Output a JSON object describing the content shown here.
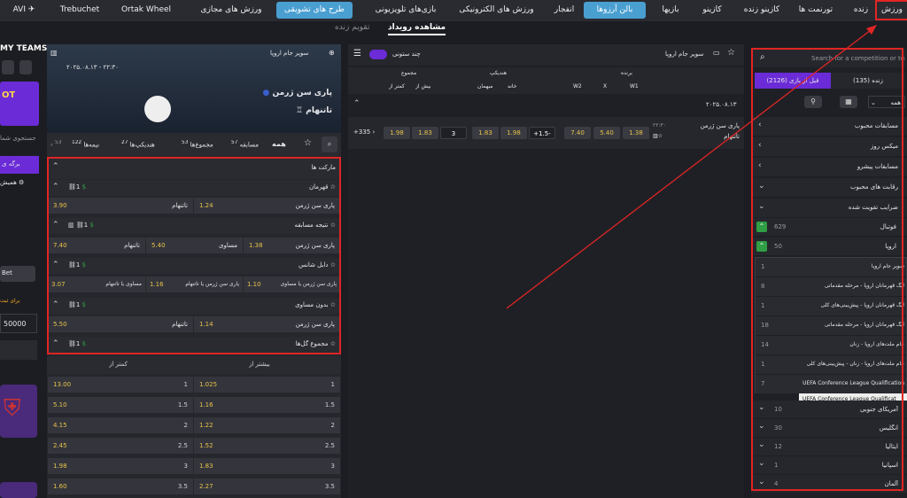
{
  "nav": {
    "items": [
      "ورزش",
      "زنده",
      "تورنمت ها",
      "کازینو زنده",
      "کازینو",
      "بازیها",
      "بالن آرزوها",
      "انفجار",
      "ورزش های الکترونیکی",
      "بازی‌های تلویزیونی",
      "طرح های تشویقی",
      "ورزش های مجازی",
      "Ortak Wheel",
      "Trebuchet",
      "AVI"
    ]
  },
  "subtabs": {
    "event": "مشاهده رویداد",
    "live": "تقویم زنده"
  },
  "left": {
    "title": "MY TEAMS",
    "search": "جستجوی شما",
    "promo": "برگه ی",
    "all": "همیش",
    "bet": "Bet",
    "register": "برای ثبت",
    "amount": "50000"
  },
  "sidebar": {
    "search_placeholder": "Search for a competition or team",
    "tabs": [
      "زنده (135)",
      "قبل از بازی (2126)"
    ],
    "filter": "همه",
    "items": [
      {
        "label": "مسابقات محبوب"
      },
      {
        "label": "میکس روز"
      },
      {
        "label": "مسابقات پیشرو"
      },
      {
        "label": "رقابت های محبوب"
      },
      {
        "label": "ضرایب تقویت شده"
      }
    ],
    "sport": {
      "label": "فوتبال",
      "count": "629"
    },
    "region": {
      "label": "اروپا",
      "count": "50"
    },
    "comps": [
      {
        "label": "سوپر جام اروپا",
        "count": "1"
      },
      {
        "label": "لیگ قهرمانان اروپا - مرحله مقدماتی",
        "count": "8"
      },
      {
        "label": "لیگ قهرمانان اروپا - پیش‌بینی‌های کلی",
        "count": "1"
      },
      {
        "label": "لیگ قهرمانان اروپا - مرحله مقدماتی",
        "count": "18"
      },
      {
        "label": "جام ملت‌های اروپا - زنان",
        "count": "14"
      },
      {
        "label": "جام ملت‌های اروپا - زنان - پیش‌بینی‌های کلی",
        "count": "1"
      },
      {
        "label": "UEFA Conference League Qualification",
        "count": "7"
      }
    ],
    "tooltip": "UEFA Conference League Qualificat",
    "countries": [
      {
        "label": "آمریکای جنوبی",
        "count": "10"
      },
      {
        "label": "انگلیس",
        "count": "30"
      },
      {
        "label": "ایتالیا",
        "count": "12"
      },
      {
        "label": "اسپانیا",
        "count": "1"
      },
      {
        "label": "آلمان",
        "count": "4"
      }
    ]
  },
  "center": {
    "competition": "سوپر جام اروپا",
    "multicol": "چند ستونی",
    "headers": {
      "winner": "برنده",
      "handicap": "هندیکپ",
      "total": "مجموع",
      "w1": "W1",
      "x": "X",
      "w2": "W2",
      "home": "خانه",
      "away": "میهمان",
      "over": "بیش از",
      "under": "کمتر از"
    },
    "date": "۲۰۲۵.۰۸.۱۳",
    "match": {
      "home": "پاری سن ژرمن",
      "away": "تاتنهام",
      "time": "۲۲:۳۰",
      "w1": "1.38",
      "x": "5.40",
      "w2": "7.40",
      "hcp": "+1.5-",
      "h1": "1.98",
      "h2": "1.83",
      "total": "3",
      "o": "1.83",
      "u": "1.98",
      "more": "+335"
    }
  },
  "right": {
    "competition": "سوپر جام اروپا",
    "datetime": "۲۰۲۵.۰۸.۱۳ - ۲۲:۳۰",
    "home": "پاری سن ژرمن",
    "away": "تاتنهام",
    "tabs": [
      {
        "label": "همه"
      },
      {
        "label": "مسابقه",
        "count": "57"
      },
      {
        "label": "مجموع‌ها",
        "count": "53"
      },
      {
        "label": "هندیکپ‌ها",
        "count": "27"
      },
      {
        "label": "نیمه‌ها",
        "count": "122"
      },
      {
        "label": "",
        "count": "53"
      }
    ],
    "markets_title": "مارکت ها",
    "m1": {
      "title": "قهرمان",
      "a": "پاری سن ژرمن",
      "av": "1.24",
      "b": "تاتنهام",
      "bv": "3.90"
    },
    "m2": {
      "title": "نتیجه مسابقه",
      "a": "پاری سن ژرمن",
      "av": "1.38",
      "b": "مساوی",
      "bv": "5.40",
      "c": "تاتنهام",
      "cv": "7.40"
    },
    "m3": {
      "title": "دابل شانس",
      "a": "پاری سن ژرمن یا مساوی",
      "av": "1.10",
      "b": "پاری سن ژرمن یا تاتنهام",
      "bv": "1.16",
      "c": "مساوی یا تاتنهام",
      "cv": "3.07"
    },
    "m4": {
      "title": "بدون مساوی",
      "a": "پاری سن ژرمن",
      "av": "1.14",
      "b": "تاتنهام",
      "bv": "5.50"
    },
    "m5": {
      "title": "مجموع گل‌ها",
      "over": "بیشتر از",
      "under": "کمتر از"
    },
    "lines": [
      {
        "l": "1",
        "o": "1.025",
        "u": "13.00"
      },
      {
        "l": "1.5",
        "o": "1.16",
        "u": "5.10"
      },
      {
        "l": "2",
        "o": "1.22",
        "u": "4.15"
      },
      {
        "l": "2.5",
        "o": "1.52",
        "u": "2.45"
      },
      {
        "l": "3",
        "o": "1.83",
        "u": "1.98"
      },
      {
        "l": "3.5",
        "o": "2.27",
        "u": "1.60"
      }
    ],
    "one": "1"
  }
}
